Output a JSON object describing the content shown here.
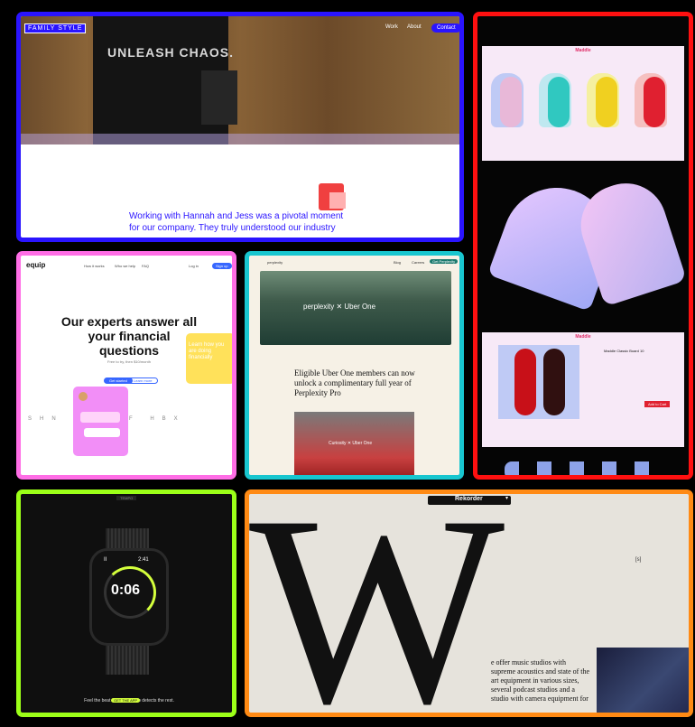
{
  "tiles": {
    "family_style": {
      "logo": "FAMILY STYLE",
      "nav": [
        "Work",
        "About"
      ],
      "cta": "Contact",
      "poster_text": "UNLEASH CHAOS.",
      "quote": "Working with Hannah and Jess was a pivotal moment for our company. They truly understood our industry"
    },
    "maddle": {
      "brand": "Maddle",
      "product_title": "Maddle Classic Board 10",
      "cart_button": "Add to Cart"
    },
    "equip": {
      "logo": "equip",
      "nav": [
        "How it works",
        "Who we help",
        "FAQ",
        "Log in"
      ],
      "cta": "Sign up",
      "headline": "Our experts answer all your financial questions",
      "subtext": "Free to try, then $10/month",
      "primary_button": "Get started",
      "secondary_button": "Learn more",
      "card_text": "Learn how you are doing financially",
      "logos": "SHN pwc wF HBX"
    },
    "perplexity": {
      "logo": "perplexity",
      "nav": [
        "Blog",
        "Careers",
        "Get Perplexity"
      ],
      "hero_text": "perplexity ✕ Uber One",
      "title": "Eligible Uber One members can now unlock a complimentary full year of Perplexity Pro",
      "photo_caption": "Curiosity ✕ Uber One"
    },
    "watch": {
      "time": "0:06",
      "corner_left": "II",
      "corner_right": "2:41",
      "caption": "Feel the beat without Tempo detects the rest.",
      "pill": "GET THE APP",
      "top_label": "TEMPO"
    },
    "rekorder": {
      "brand": "Rekorder",
      "caret": "▾",
      "big_letter": "W",
      "body": "e offer music studios with supreme acoustics and state of the art equipment in various sizes, several podcast studios and a studio with camera equipment for",
      "mark": "[s]"
    }
  },
  "colors": {
    "blue": "#2a14ff",
    "red": "#ff1010",
    "pink": "#ff6ee6",
    "teal": "#18c6cf",
    "lime": "#9cff18",
    "orange": "#ff8a14"
  }
}
